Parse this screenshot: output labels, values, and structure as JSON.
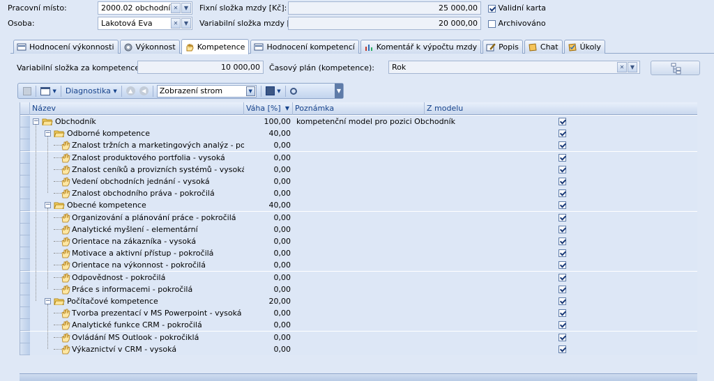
{
  "header": {
    "workplace_label": "Pracovní místo:",
    "workplace_value": "2000.02 obchodní...",
    "person_label": "Osoba:",
    "person_value": "Lakotová Eva",
    "fixed_salary_label": "Fixní složka mzdy [Kč]:",
    "fixed_salary_value": "25 000,00",
    "variable_salary_label": "Variabilní složka mzdy [Kč]:",
    "variable_salary_value": "20 000,00",
    "valid_card_label": "Validní karta",
    "valid_card_checked": true,
    "archived_label": "Archivováno",
    "archived_checked": false
  },
  "tabs": [
    {
      "label": "Hodnocení výkonnosti",
      "icon": "report-icon"
    },
    {
      "label": "Výkonnost",
      "icon": "gear-icon"
    },
    {
      "label": "Kompetence",
      "icon": "hand-icon",
      "active": true
    },
    {
      "label": "Hodnocení kompetencí",
      "icon": "report-icon"
    },
    {
      "label": "Komentář k výpočtu mzdy",
      "icon": "chart-icon"
    },
    {
      "label": "Popis",
      "icon": "edit-icon"
    },
    {
      "label": "Chat",
      "icon": "note-icon"
    },
    {
      "label": "Úkoly",
      "icon": "task-icon"
    }
  ],
  "competence_panel": {
    "variable_part_label": "Variabilní složka za kompetence [Kč]:",
    "variable_part_value": "10 000,00",
    "time_plan_label": "Časový plán (kompetence):",
    "time_plan_value": "Rok"
  },
  "toolbar": {
    "diagnostics_label": "Diagnostika",
    "view_value": "Zobrazení strom"
  },
  "grid": {
    "columns": [
      "Název",
      "Váha [%]",
      "Poznámka",
      "Z modelu"
    ],
    "rows": [
      {
        "level": 0,
        "type": "folder",
        "name": "Obchodník",
        "weight": "100,00",
        "note": "kompetenční model pro pozici Obchodník",
        "from_model": true
      },
      {
        "level": 1,
        "type": "folder",
        "name": "Odborné kompetence",
        "weight": "40,00",
        "note": "",
        "from_model": true
      },
      {
        "level": 2,
        "type": "item",
        "name": "Znalost tržních a marketingových analýz - pokr...",
        "weight": "0,00",
        "note": "",
        "from_model": true
      },
      {
        "level": 2,
        "type": "item",
        "name": "Znalost produktového portfolia - vysoká",
        "weight": "0,00",
        "note": "",
        "from_model": true
      },
      {
        "level": 2,
        "type": "item",
        "name": "Znalost ceníků a provizních systémů - vysoká",
        "weight": "0,00",
        "note": "",
        "from_model": true
      },
      {
        "level": 2,
        "type": "item",
        "name": "Vedení obchodních jednání - vysoká",
        "weight": "0,00",
        "note": "",
        "from_model": true
      },
      {
        "level": 2,
        "type": "item",
        "name": "Znalost obchodního práva - pokročilá",
        "weight": "0,00",
        "note": "",
        "from_model": true
      },
      {
        "level": 1,
        "type": "folder",
        "name": "Obecné kompetence",
        "weight": "40,00",
        "note": "",
        "from_model": true
      },
      {
        "level": 2,
        "type": "item",
        "name": "Organizování a plánování práce - pokročilá",
        "weight": "0,00",
        "note": "",
        "from_model": true
      },
      {
        "level": 2,
        "type": "item",
        "name": "Analytické myšlení - elementární",
        "weight": "0,00",
        "note": "",
        "from_model": true
      },
      {
        "level": 2,
        "type": "item",
        "name": "Orientace na zákazníka - vysoká",
        "weight": "0,00",
        "note": "",
        "from_model": true
      },
      {
        "level": 2,
        "type": "item",
        "name": "Motivace a aktivní přístup - pokročilá",
        "weight": "0,00",
        "note": "",
        "from_model": true
      },
      {
        "level": 2,
        "type": "item",
        "name": "Orientace na výkonnost - pokročilá",
        "weight": "0,00",
        "note": "",
        "from_model": true
      },
      {
        "level": 2,
        "type": "item",
        "name": "Odpovědnost - pokročilá",
        "weight": "0,00",
        "note": "",
        "from_model": true
      },
      {
        "level": 2,
        "type": "item",
        "name": "Práce s informacemi - pokročilá",
        "weight": "0,00",
        "note": "",
        "from_model": true
      },
      {
        "level": 1,
        "type": "folder",
        "name": "Počítačové kompetence",
        "weight": "20,00",
        "note": "",
        "from_model": true
      },
      {
        "level": 2,
        "type": "item",
        "name": "Tvorba prezentací v MS Powerpoint - vysoká",
        "weight": "0,00",
        "note": "",
        "from_model": true
      },
      {
        "level": 2,
        "type": "item",
        "name": "Analytické funkce CRM - pokročilá",
        "weight": "0,00",
        "note": "",
        "from_model": true
      },
      {
        "level": 2,
        "type": "item",
        "name": "Ovládání MS Outlook - pokročiklá",
        "weight": "0,00",
        "note": "",
        "from_model": true
      },
      {
        "level": 2,
        "type": "item",
        "name": "Výkaznictví v CRM - vysoká",
        "weight": "0,00",
        "note": "",
        "from_model": true
      }
    ]
  },
  "colors": {
    "accent": "#15428b",
    "row_bg": "#dde7f6",
    "header_bg": "#c9d8ee"
  }
}
